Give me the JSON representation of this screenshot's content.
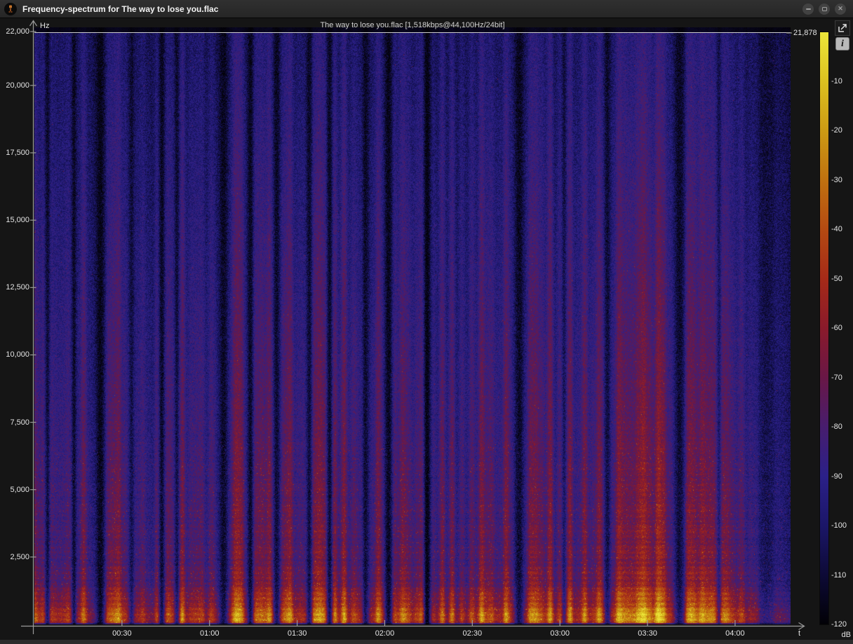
{
  "window": {
    "title": "Frequency-spectrum for The way to lose you.flac",
    "close_glyph": "✕"
  },
  "toolbar": {
    "info_glyph": "i"
  },
  "plot": {
    "caption": "The way to lose you.flac [1,518kbps@44,100Hz/24bit]",
    "y_axis": {
      "unit": "Hz",
      "max_hz": 22000,
      "ticks": [
        {
          "value": 22000,
          "label": "22,000"
        },
        {
          "value": 20000,
          "label": "20,000"
        },
        {
          "value": 17500,
          "label": "17,500"
        },
        {
          "value": 15000,
          "label": "15,000"
        },
        {
          "value": 12500,
          "label": "12,500"
        },
        {
          "value": 10000,
          "label": "10,000"
        },
        {
          "value": 7500,
          "label": "7,500"
        },
        {
          "value": 5000,
          "label": "5,000"
        },
        {
          "value": 2500,
          "label": "2,500"
        }
      ]
    },
    "x_axis": {
      "unit": "t",
      "duration_seconds": 259,
      "ticks": [
        {
          "value": 30,
          "label": "00:30"
        },
        {
          "value": 60,
          "label": "01:00"
        },
        {
          "value": 90,
          "label": "01:30"
        },
        {
          "value": 120,
          "label": "02:00"
        },
        {
          "value": 150,
          "label": "02:30"
        },
        {
          "value": 180,
          "label": "03:00"
        },
        {
          "value": 210,
          "label": "03:30"
        },
        {
          "value": 240,
          "label": "04:00"
        }
      ]
    },
    "cutoff": {
      "label": "21,878",
      "hz": 21878
    },
    "colorbar": {
      "unit": "dB",
      "min_db": -120,
      "max_db": 0,
      "ticks": [
        {
          "db": -10,
          "label": "-10"
        },
        {
          "db": -20,
          "label": "-20"
        },
        {
          "db": -30,
          "label": "-30"
        },
        {
          "db": -40,
          "label": "-40"
        },
        {
          "db": -50,
          "label": "-50"
        },
        {
          "db": -60,
          "label": "-60"
        },
        {
          "db": -70,
          "label": "-70"
        },
        {
          "db": -80,
          "label": "-80"
        },
        {
          "db": -90,
          "label": "-90"
        },
        {
          "db": -100,
          "label": "-100"
        },
        {
          "db": -110,
          "label": "-110"
        },
        {
          "db": -120,
          "label": "-120"
        }
      ]
    }
  },
  "spectrogram": {
    "seed": 20,
    "palette": [
      {
        "v": 0.0,
        "color": "#020106"
      },
      {
        "v": 0.083,
        "color": "#0d0a36"
      },
      {
        "v": 0.167,
        "color": "#1b1668"
      },
      {
        "v": 0.25,
        "color": "#2b2088"
      },
      {
        "v": 0.333,
        "color": "#471d6e"
      },
      {
        "v": 0.417,
        "color": "#691746"
      },
      {
        "v": 0.5,
        "color": "#8a1a2b"
      },
      {
        "v": 0.583,
        "color": "#a52a18"
      },
      {
        "v": 0.667,
        "color": "#b44a12"
      },
      {
        "v": 0.75,
        "color": "#c07110"
      },
      {
        "v": 0.833,
        "color": "#cc9a14"
      },
      {
        "v": 0.917,
        "color": "#dcc120"
      },
      {
        "v": 1.0,
        "color": "#ece63a"
      }
    ],
    "envelope": [
      [
        0.0,
        0.74
      ],
      [
        0.02,
        0.82
      ],
      [
        0.1,
        0.78
      ],
      [
        0.25,
        0.8
      ],
      [
        0.4,
        0.82
      ],
      [
        0.515,
        0.8
      ],
      [
        0.527,
        0.88
      ],
      [
        0.7,
        0.9
      ],
      [
        0.8,
        0.86
      ],
      [
        0.9,
        0.8
      ],
      [
        0.93,
        0.62
      ],
      [
        0.95,
        0.45
      ],
      [
        0.985,
        0.4
      ],
      [
        1.0,
        0.28
      ]
    ],
    "gaps": [
      {
        "c": 0.017,
        "w": 0.004,
        "d": 0.75
      },
      {
        "c": 0.052,
        "w": 0.004,
        "d": 0.8
      },
      {
        "c": 0.087,
        "w": 0.006,
        "d": 0.85
      },
      {
        "c": 0.128,
        "w": 0.004,
        "d": 0.6
      },
      {
        "c": 0.168,
        "w": 0.004,
        "d": 0.75
      },
      {
        "c": 0.188,
        "w": 0.004,
        "d": 0.7
      },
      {
        "c": 0.25,
        "w": 0.009,
        "d": 0.85
      },
      {
        "c": 0.285,
        "w": 0.004,
        "d": 0.75
      },
      {
        "c": 0.32,
        "w": 0.006,
        "d": 0.8
      },
      {
        "c": 0.363,
        "w": 0.004,
        "d": 0.7
      },
      {
        "c": 0.39,
        "w": 0.004,
        "d": 0.75
      },
      {
        "c": 0.437,
        "w": 0.005,
        "d": 0.8
      },
      {
        "c": 0.468,
        "w": 0.007,
        "d": 0.85
      },
      {
        "c": 0.519,
        "w": 0.005,
        "d": 0.97
      },
      {
        "c": 0.641,
        "w": 0.007,
        "d": 0.8
      },
      {
        "c": 0.7,
        "w": 0.003,
        "d": 0.5
      },
      {
        "c": 0.757,
        "w": 0.006,
        "d": 0.75
      },
      {
        "c": 0.852,
        "w": 0.008,
        "d": 0.8
      },
      {
        "c": 0.905,
        "w": 0.003,
        "d": 0.5
      }
    ]
  },
  "colors": {
    "cutoff_line": "#c9c9c9",
    "axis": "#9a9a9a",
    "label": "#e4e4e4"
  }
}
